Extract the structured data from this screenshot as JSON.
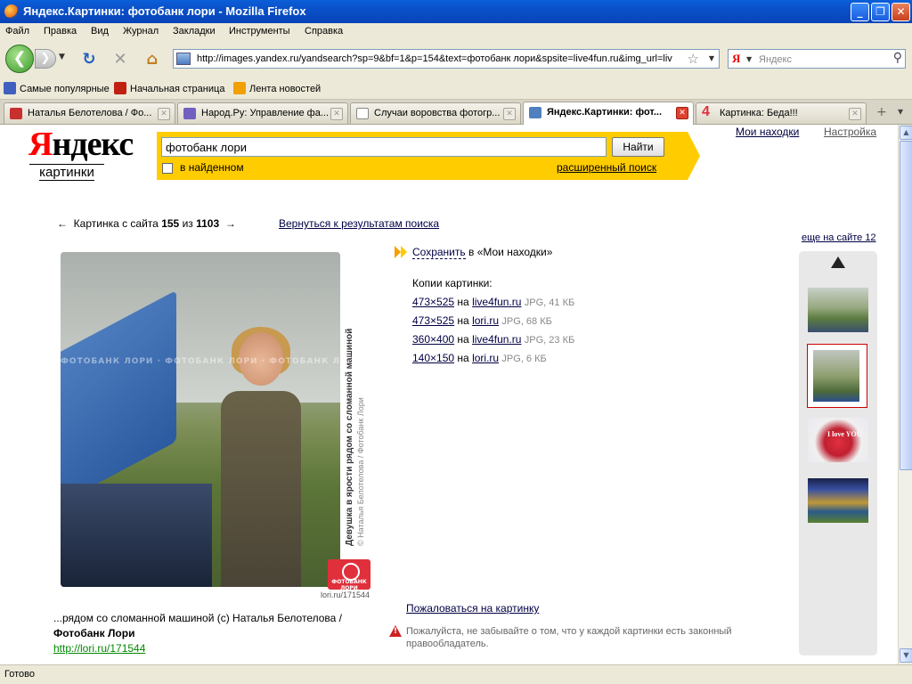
{
  "window": {
    "title": "Яндекс.Картинки: фотобанк лори - Mozilla Firefox",
    "minimize": "_",
    "maximize": "❐",
    "close": "✕"
  },
  "menu": [
    "Файл",
    "Правка",
    "Вид",
    "Журнал",
    "Закладки",
    "Инструменты",
    "Справка"
  ],
  "toolbar": {
    "url": "http://images.yandex.ru/yandsearch?sp=9&bf=1&p=154&text=фотобанк лори&spsite=live4fun.ru&img_url=liv",
    "search_engine_letter": "Я",
    "search_placeholder": "Яндекс"
  },
  "bookmarks": [
    {
      "label": "Самые популярные",
      "color": "#4060c0"
    },
    {
      "label": "Начальная страница",
      "color": "#c02010"
    },
    {
      "label": "Лента новостей",
      "color": "#f0a000"
    }
  ],
  "tabs": [
    {
      "label": "Наталья Белотелова / Фо...",
      "color": "#c83030",
      "active": false
    },
    {
      "label": "Народ.Ру: Управление фа...",
      "color": "#7060c0",
      "active": false
    },
    {
      "label": "Случаи воровства фотогр...",
      "color": "#ffffff",
      "active": false
    },
    {
      "label": "Яндекс.Картинки: фот...",
      "color": "#5080c0",
      "active": true
    },
    {
      "label": "Картинка: Беда!!!",
      "color": "#e03040",
      "active": false
    }
  ],
  "tab_close": "✕",
  "tab_new": "+",
  "tab_list": "▾",
  "page": {
    "logo_first": "Я",
    "logo_rest": "ндекс",
    "logo_sub": "картинки",
    "search_value": "фотобанк лори",
    "search_button": "Найти",
    "in_found": "в найденном",
    "advanced": "расширенный поиск",
    "my_finds": "Мои находки",
    "settings": "Настройка",
    "pager_prefix": "Картинка с сайта",
    "pager_current": "155",
    "pager_of": "из",
    "pager_total": "1103",
    "prev_arrow": "←",
    "next_arrow": "→",
    "back_to_results": "Вернуться к результатам поиска",
    "save_link": "Сохранить",
    "save_suffix": "в «Мои находки»",
    "copies_title": "Копии картинки:",
    "copies": [
      {
        "size": "473×525",
        "on": "на",
        "site": "live4fun.ru",
        "meta": "JPG, 41 КБ"
      },
      {
        "size": "473×525",
        "on": "на",
        "site": "lori.ru",
        "meta": "JPG, 68 КБ"
      },
      {
        "size": "360×400",
        "on": "на",
        "site": "live4fun.ru",
        "meta": "JPG, 23 КБ"
      },
      {
        "size": "140×150",
        "on": "на",
        "site": "lori.ru",
        "meta": "JPG, 6 КБ"
      }
    ],
    "more_on_site": "еще на сайте 12",
    "photo_side_title": "Девушка в ярости рядом со сломанной машиной",
    "photo_side_author": "© Наталья Белотелова / Фотобанк Лори",
    "photo_watermark": "ФОТОБАНК ЛОРИ · ФОТОБАНК ЛОРИ · ФОТОБАНК ЛОРИ",
    "photo_badge": "ФОТОБАНК ЛОРИ",
    "photo_url_small": "lori.ru/171544",
    "caption_text": "...рядом со сломанной машиной (c) Наталья Белотелова /",
    "caption_bold": "Фотобанк Лори",
    "caption_link": "http://lori.ru/171544",
    "complain": "Пожаловаться на картинку",
    "warning": "Пожалуйста, не забывайте о том, что у каждой картинки есть законный правообладатель.",
    "thumb_heart_text": "I love YOU"
  },
  "status": "Готово"
}
